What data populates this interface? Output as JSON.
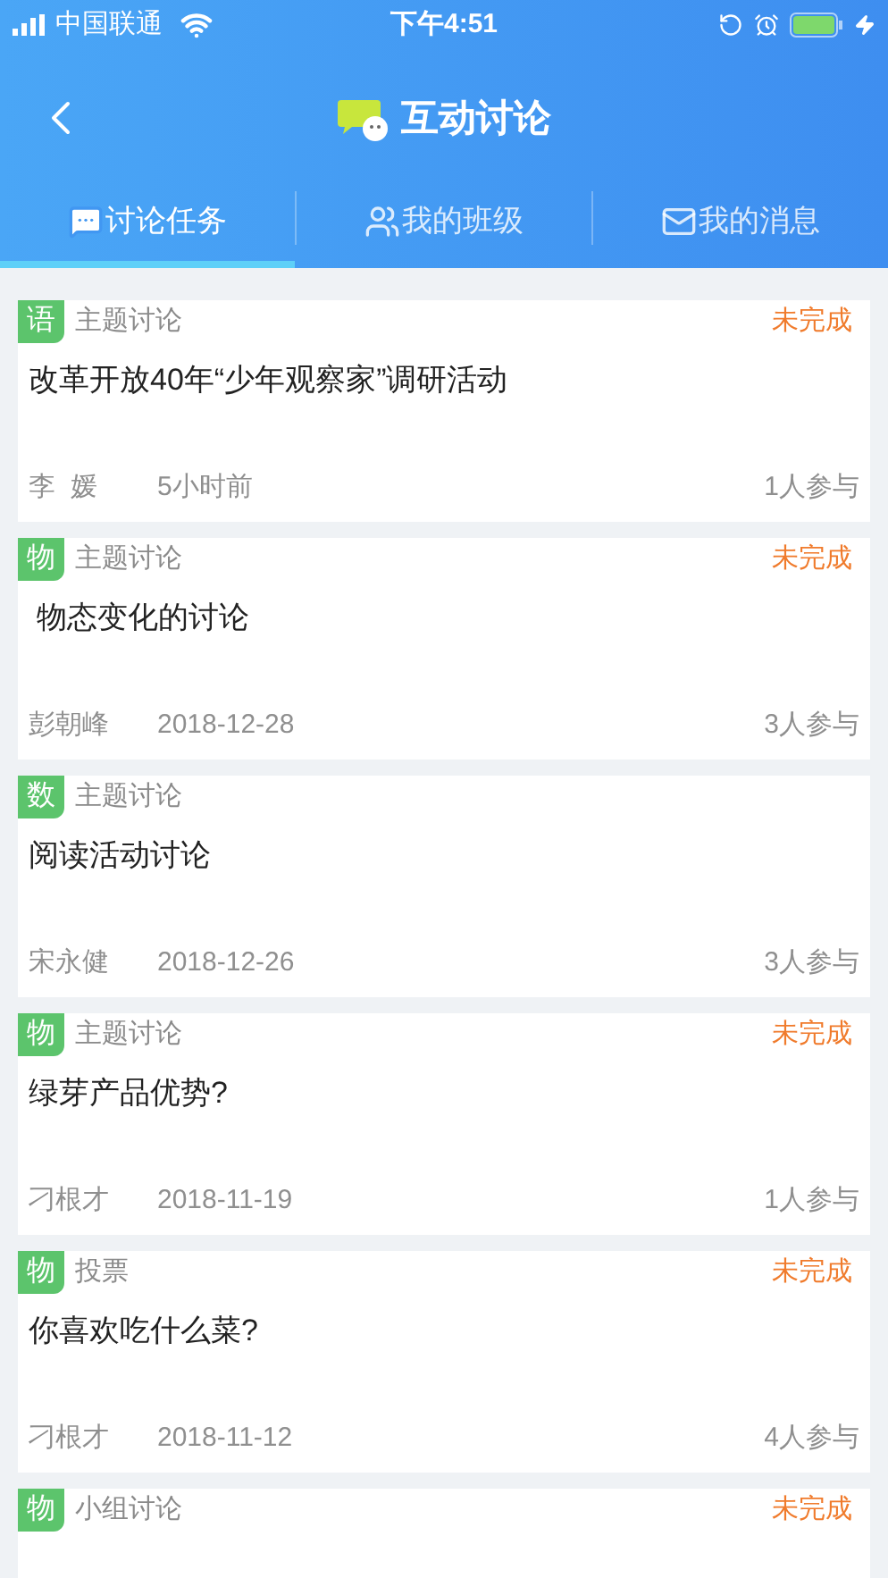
{
  "status_bar": {
    "carrier": "中国联通",
    "time": "下午4:51"
  },
  "nav": {
    "title": "互动讨论"
  },
  "tabs": [
    {
      "label": "讨论任务",
      "kind": "chat",
      "selected": true
    },
    {
      "label": "我的班级",
      "kind": "people",
      "selected": false
    },
    {
      "label": "我的消息",
      "kind": "mail",
      "selected": false
    }
  ],
  "tasks": [
    {
      "subject": "语",
      "type": "主题讨论",
      "status": "未完成",
      "title": "改革开放40年“少年观察家”调研活动",
      "author": "李  媛",
      "time": "5小时前",
      "participants": "1人参与"
    },
    {
      "subject": "物",
      "type": "主题讨论",
      "status": "未完成",
      "title": " 物态变化的讨论",
      "author": "彭朝峰",
      "time": "2018-12-28",
      "participants": "3人参与"
    },
    {
      "subject": "数",
      "type": "主题讨论",
      "title": "阅读活动讨论",
      "author": "宋永健",
      "time": "2018-12-26",
      "participants": "3人参与"
    },
    {
      "subject": "物",
      "type": "主题讨论",
      "status": "未完成",
      "title": "绿芽产品优势?",
      "author": "刁根才",
      "time": "2018-11-19",
      "participants": "1人参与"
    },
    {
      "subject": "物",
      "type": "投票",
      "status": "未完成",
      "title": "你喜欢吃什么菜?",
      "author": "刁根才",
      "time": "2018-11-12",
      "participants": "4人参与"
    },
    {
      "subject": "物",
      "type": "小组讨论",
      "status": "未完成"
    }
  ]
}
